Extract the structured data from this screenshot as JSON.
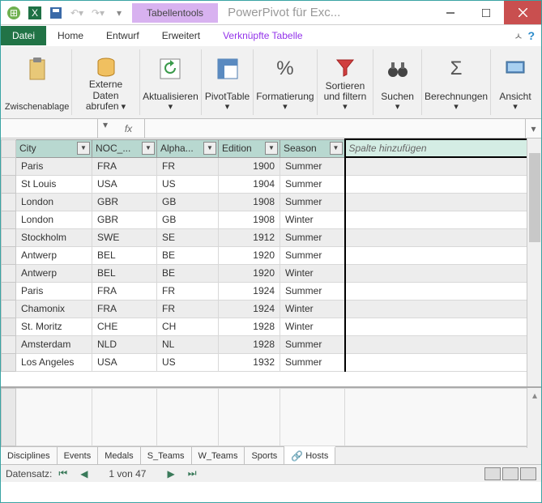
{
  "title_context": "Tabellentools",
  "app_title": "PowerPivot für Exc...",
  "menu": {
    "datei": "Datei",
    "home": "Home",
    "entwurf": "Entwurf",
    "erweitert": "Erweitert",
    "verk": "Verknüpfte Tabelle"
  },
  "ribbon": {
    "zwischen": "Zwischenablage",
    "extern": "Externe Daten\nabrufen",
    "aktual": "Aktualisieren",
    "pivot": "PivotTable",
    "format": "Formatierung",
    "sort": "Sortieren\nund filtern",
    "suchen": "Suchen",
    "berech": "Berechnungen",
    "ansicht": "Ansicht"
  },
  "columns": [
    "City",
    "NOC_...",
    "Alpha...",
    "Edition",
    "Season"
  ],
  "add_column": "Spalte hinzufügen",
  "rows": [
    {
      "city": "Paris",
      "noc": "FRA",
      "alpha": "FR",
      "edition": "1900",
      "season": "Summer"
    },
    {
      "city": "St Louis",
      "noc": "USA",
      "alpha": "US",
      "edition": "1904",
      "season": "Summer"
    },
    {
      "city": "London",
      "noc": "GBR",
      "alpha": "GB",
      "edition": "1908",
      "season": "Summer"
    },
    {
      "city": "London",
      "noc": "GBR",
      "alpha": "GB",
      "edition": "1908",
      "season": "Winter"
    },
    {
      "city": "Stockholm",
      "noc": "SWE",
      "alpha": "SE",
      "edition": "1912",
      "season": "Summer"
    },
    {
      "city": "Antwerp",
      "noc": "BEL",
      "alpha": "BE",
      "edition": "1920",
      "season": "Summer"
    },
    {
      "city": "Antwerp",
      "noc": "BEL",
      "alpha": "BE",
      "edition": "1920",
      "season": "Winter"
    },
    {
      "city": "Paris",
      "noc": "FRA",
      "alpha": "FR",
      "edition": "1924",
      "season": "Summer"
    },
    {
      "city": "Chamonix",
      "noc": "FRA",
      "alpha": "FR",
      "edition": "1924",
      "season": "Winter"
    },
    {
      "city": "St. Moritz",
      "noc": "CHE",
      "alpha": "CH",
      "edition": "1928",
      "season": "Winter"
    },
    {
      "city": "Amsterdam",
      "noc": "NLD",
      "alpha": "NL",
      "edition": "1928",
      "season": "Summer"
    },
    {
      "city": "Los Angeles",
      "noc": "USA",
      "alpha": "US",
      "edition": "1932",
      "season": "Summer"
    }
  ],
  "sheets": [
    "Disciplines",
    "Events",
    "Medals",
    "S_Teams",
    "W_Teams",
    "Sports",
    "Hosts"
  ],
  "status": {
    "label": "Datensatz:",
    "pos": "1 von 47"
  }
}
